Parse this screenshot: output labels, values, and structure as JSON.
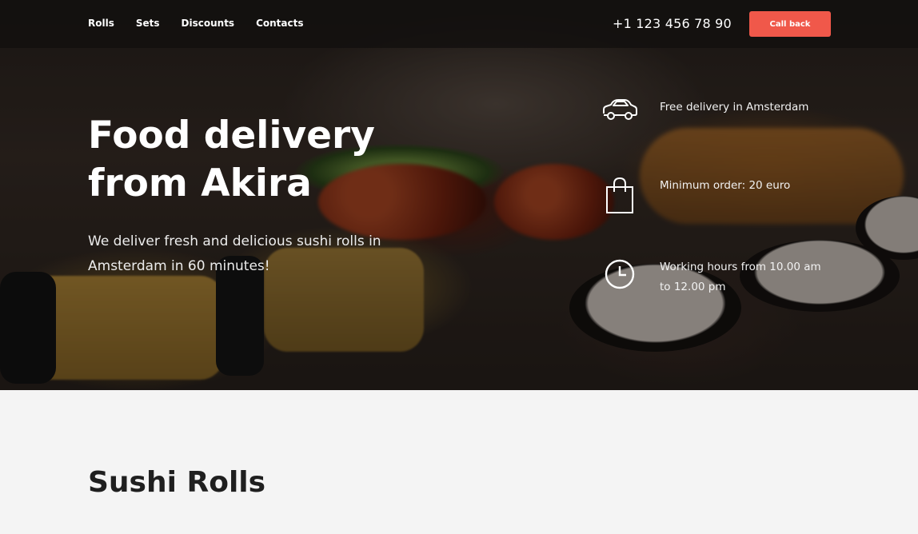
{
  "nav": {
    "items": [
      "Rolls",
      "Sets",
      "Discounts",
      "Contacts"
    ]
  },
  "header": {
    "phone": "+1 123 456 78 90",
    "callback_label": "Call back"
  },
  "hero": {
    "title": "Food delivery from Akira",
    "subtitle": "We deliver fresh and delicious sushi rolls in Amsterdam in 60 minutes!"
  },
  "features": [
    {
      "icon": "car-icon",
      "text": "Free delivery in Amsterdam"
    },
    {
      "icon": "shopping-bag-icon",
      "text": "Minimum order: 20 euro"
    },
    {
      "icon": "clock-icon",
      "text": "Working hours from 10.00 am to 12.00 pm"
    }
  ],
  "content": {
    "section_title": "Sushi Rolls"
  },
  "colors": {
    "accent": "#f0584a",
    "header_bg": "#12100f",
    "page_bg": "#f4f4f4",
    "heading": "#1f1f1f"
  }
}
